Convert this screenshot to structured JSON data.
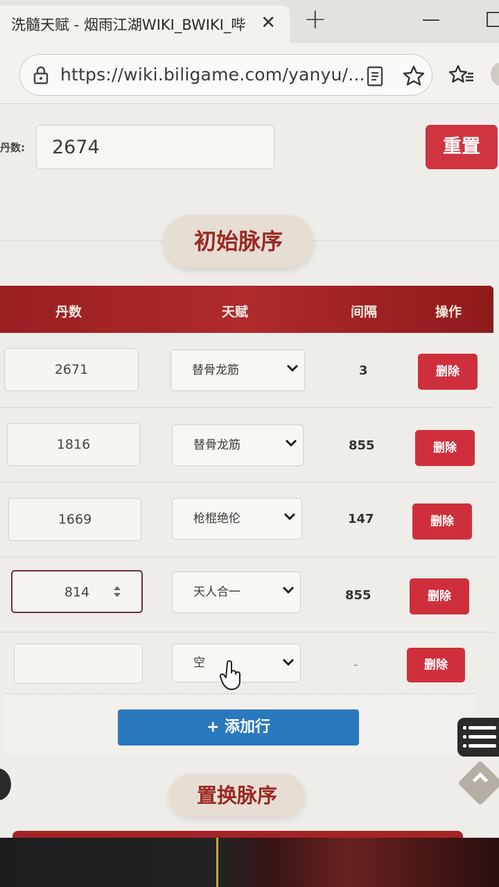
{
  "browser": {
    "tab_title": "洗髓天赋 - 烟雨江湖WIKI_BWIKI_哔",
    "url": "https://wiki.biligame.com/yanyu/..."
  },
  "calculator": {
    "count_label": "丹数:",
    "count_value": "2674",
    "reset_label": "重置",
    "initial_section_title": "初始脉序",
    "replace_section_title": "置换脉序",
    "columns": [
      "丹数",
      "天赋",
      "间隔",
      "操作"
    ],
    "rows": [
      {
        "dan": "2671",
        "talent": "替骨龙筋",
        "gap": "3",
        "action": "删除"
      },
      {
        "dan": "1816",
        "talent": "替骨龙筋",
        "gap": "855",
        "action": "删除"
      },
      {
        "dan": "1669",
        "talent": "枪棍绝伦",
        "gap": "147",
        "action": "删除"
      },
      {
        "dan": "814",
        "talent": "天人合一",
        "gap": "855",
        "action": "删除"
      },
      {
        "dan": "",
        "talent": "空",
        "gap": "-",
        "action": "删除"
      }
    ],
    "add_row_label": "+ 添加行"
  }
}
